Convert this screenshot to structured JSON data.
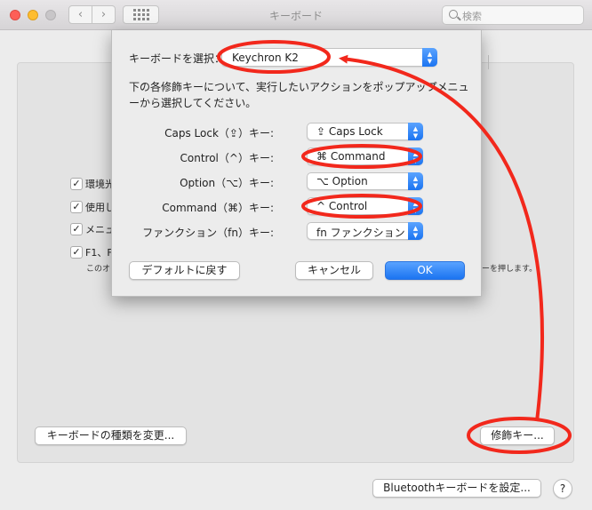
{
  "window": {
    "title": "キーボード",
    "search_placeholder": "検索",
    "nav_back": "‹",
    "nav_forward": "›"
  },
  "background_panel": {
    "checkboxes": [
      {
        "label": "環境光",
        "checked": true
      },
      {
        "label": "使用し",
        "checked": true
      },
      {
        "label": "メニュ",
        "checked": true
      },
      {
        "label": "F1、F",
        "checked": true
      }
    ],
    "description_left": "このオ",
    "description_right": "ーを押します。",
    "keyboard_type_button": "キーボードの種類を変更...",
    "modifier_keys_button": "修飾キー...",
    "bluetooth_button": "Bluetoothキーボードを設定...",
    "help_button": "?"
  },
  "sheet": {
    "select_keyboard_label": "キーボードを選択：",
    "selected_keyboard": "Keychron K2",
    "instructions": "下の各修飾キーについて、実行したいアクションをポップアップメニューから選択してください。",
    "rows": [
      {
        "key": "Caps Lock（⇪）キー:",
        "action": "⇪ Caps Lock"
      },
      {
        "key": "Control（^）キー:",
        "action": "⌘ Command"
      },
      {
        "key": "Option（⌥）キー:",
        "action": "⌥ Option"
      },
      {
        "key": "Command（⌘）キー:",
        "action": "^ Control"
      },
      {
        "key": "ファンクション（fn）キー:",
        "action": "fn ファンクション"
      }
    ],
    "restore_defaults_button": "デフォルトに戻す",
    "cancel_button": "キャンセル",
    "ok_button": "OK"
  },
  "colors": {
    "accent": "#1b74f1",
    "annotation": "#f2281c"
  }
}
